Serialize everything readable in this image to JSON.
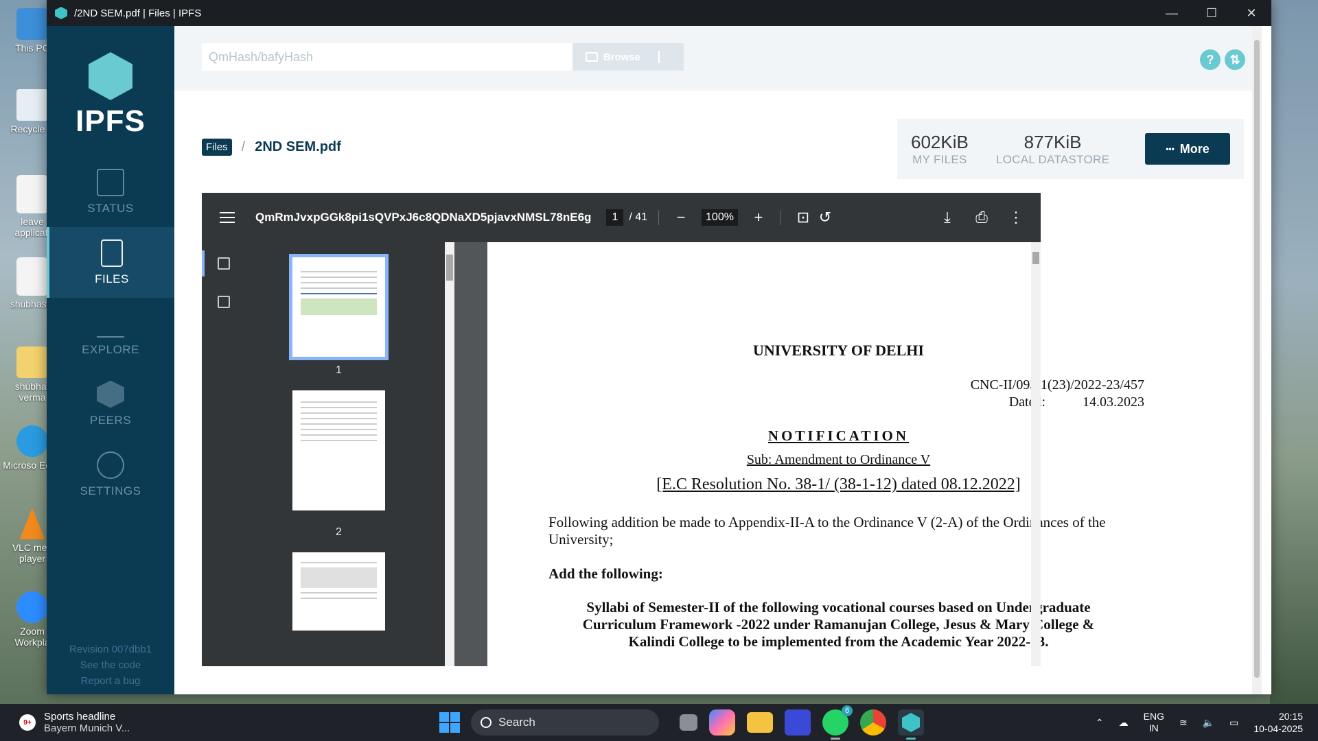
{
  "desktop": {
    "icons": [
      {
        "label": "This PC"
      },
      {
        "label": "Recycle B"
      },
      {
        "label": "leave applicati"
      },
      {
        "label": "shubhasm"
      },
      {
        "label": "shubhar verma"
      },
      {
        "label": "Microso Edge"
      },
      {
        "label": "VLC med player"
      },
      {
        "label": "Zoom Workpla"
      }
    ]
  },
  "window": {
    "title": "/2ND SEM.pdf | Files | IPFS",
    "controls": {
      "minimize": "—",
      "maximize": "☐",
      "close": "✕"
    }
  },
  "sidebar": {
    "logo_text": "IPFS",
    "items": [
      {
        "label": "STATUS",
        "icon": "status-chart-icon",
        "active": false
      },
      {
        "label": "FILES",
        "icon": "files-icon",
        "active": true
      },
      {
        "label": "EXPLORE",
        "icon": "explore-tree-icon",
        "active": false
      },
      {
        "label": "PEERS",
        "icon": "peers-cube-icon",
        "active": false
      },
      {
        "label": "SETTINGS",
        "icon": "gear-icon",
        "active": false
      }
    ],
    "footer": {
      "revision": "Revision 007dbb1",
      "code_link": "See the code",
      "bug_link": "Report a bug"
    }
  },
  "topbar": {
    "hash_placeholder": "QmHash/bafyHash",
    "browse_label": "Browse",
    "help_label": "?",
    "sync_label": "⇅"
  },
  "breadcrumb": {
    "root": "Files",
    "separator": "/",
    "current": "2ND SEM.pdf"
  },
  "stats": {
    "my_files": {
      "value": "602KiB",
      "label": "MY FILES"
    },
    "datastore": {
      "value": "877KiB",
      "label": "LOCAL DATASTORE"
    },
    "more_label": "More",
    "more_icon": "•••"
  },
  "pdf_viewer": {
    "file_hash": "QmRmJvxpGGk8pi1sQVPxJ6c8QDNaXD5pjavxNMSL78nE6g",
    "current_page": "1",
    "total_pages": "/ 41",
    "zoom": "100%",
    "thumbnails": [
      {
        "number": "1"
      },
      {
        "number": "2"
      }
    ],
    "page": {
      "heading": "UNIVERSITY OF DELHI",
      "ref_no": "CNC-II/093/1(23)/2022-23/457",
      "dated_label": "Dated:",
      "dated_value": "14.03.2023",
      "notification": "NOTIFICATION",
      "subject": "Sub:  Amendment to Ordinance V",
      "resolution": "[E.C Resolution No. 38-1/ (38-1-12) dated 08.12.2022]",
      "paragraph": "Following addition be made to Appendix-II-A to the Ordinance V (2-A) of the Ordinances of the University;",
      "add_following": "Add the following:",
      "syllabi": "Syllabi of Semester-II of the following vocational courses based on Undergraduate Curriculum Framework -2022 under Ramanujan College, Jesus & Mary College & Kalindi College to be implemented from the Academic Year 2022-23."
    }
  },
  "taskbar": {
    "news_badge": "9+",
    "news_title": "Sports headline",
    "news_sub": "Bayern Munich V...",
    "search_label": "Search",
    "whatsapp_badge": "6",
    "lang_line1": "ENG",
    "lang_line2": "IN",
    "time": "20:15",
    "date": "10-04-2025"
  }
}
